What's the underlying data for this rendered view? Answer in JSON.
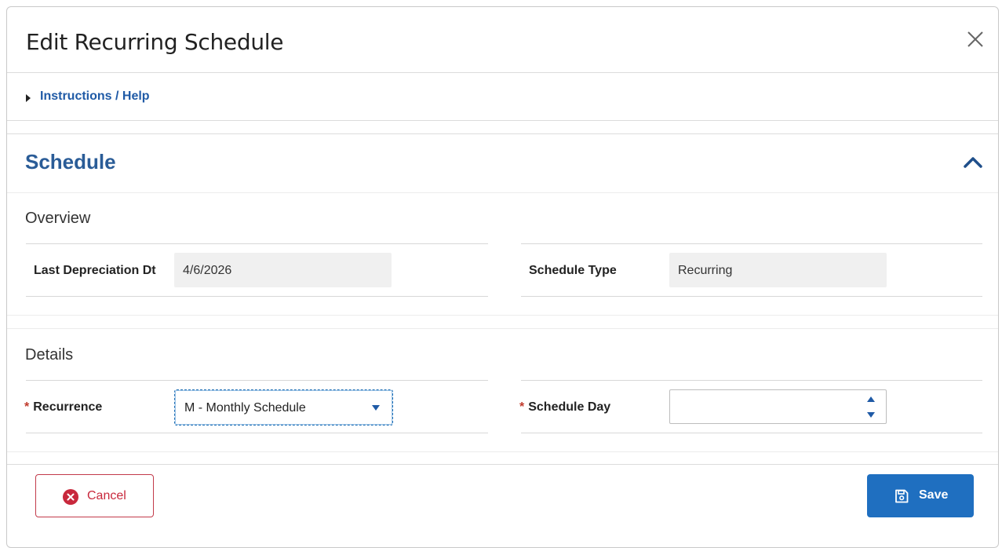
{
  "modal": {
    "title": "Edit Recurring Schedule"
  },
  "help": {
    "link_label": "Instructions / Help"
  },
  "section": {
    "title": "Schedule"
  },
  "overview": {
    "title": "Overview",
    "last_depreciation_label": "Last Depreciation Dt",
    "last_depreciation_value": "4/6/2026",
    "schedule_type_label": "Schedule Type",
    "schedule_type_value": "Recurring"
  },
  "details": {
    "title": "Details",
    "required_mark": "*",
    "recurrence_label": "Recurrence",
    "recurrence_value": "M - Monthly Schedule",
    "schedule_day_label": "Schedule Day",
    "schedule_day_value": ""
  },
  "footer": {
    "cancel_label": "Cancel",
    "save_label": "Save"
  },
  "colors": {
    "accent": "#1f6fc0",
    "link": "#1f5aa6",
    "section_title": "#2a5c97",
    "danger": "#c8283c"
  },
  "icons": {
    "close": "close-icon",
    "help_toggle": "caret-right-icon",
    "collapse": "chevron-up-icon",
    "select": "caret-down-icon",
    "cancel": "close-circle-icon",
    "save": "floppy-disk-icon"
  }
}
